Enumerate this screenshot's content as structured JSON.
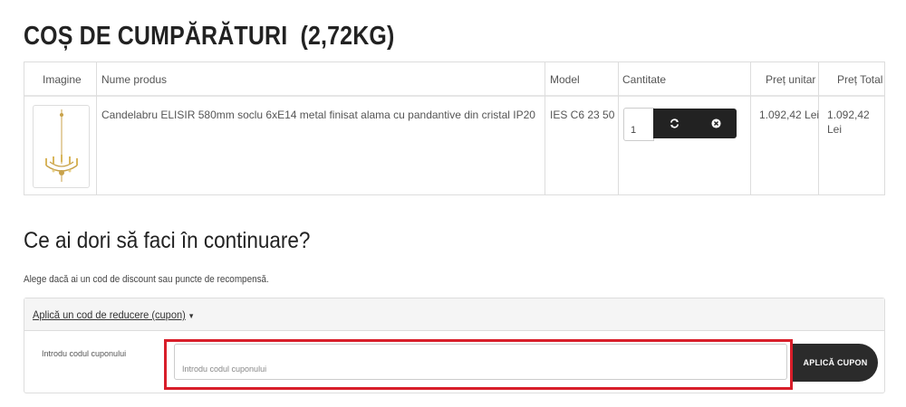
{
  "page": {
    "title": "COȘ DE CUMPĂRĂTURI",
    "weight": "(2,72KG)"
  },
  "cart": {
    "headers": {
      "image": "Imagine",
      "name": "Nume produs",
      "model": "Model",
      "quantity": "Cantitate",
      "unit_price": "Preț unitar",
      "total_price": "Preț Total"
    },
    "items": [
      {
        "image_icon": "chandelier-image",
        "name": "Candelabru ELISIR 580mm soclu 6xE14 metal finisat alama cu pandantive din cristal IP20",
        "model": "IES C6 23 50",
        "quantity": "1",
        "unit_price": "1.092,42 Lei",
        "total_price": "1.092,42 Lei",
        "update_icon": "refresh-icon",
        "remove_icon": "remove-icon"
      }
    ]
  },
  "next_steps": {
    "heading": "Ce ai dori să faci în continuare?",
    "description": "Alege dacă ai un cod de discount sau puncte de recompensă.",
    "coupon": {
      "toggle_label": "Aplică un cod de reducere (cupon)",
      "field_label": "Introdu codul cuponului",
      "placeholder": "Introdu codul cuponului",
      "value": "",
      "apply_label": "APLICĂ CUPON"
    }
  },
  "colors": {
    "highlight": "#d81e2a",
    "button_dark": "#222222"
  }
}
